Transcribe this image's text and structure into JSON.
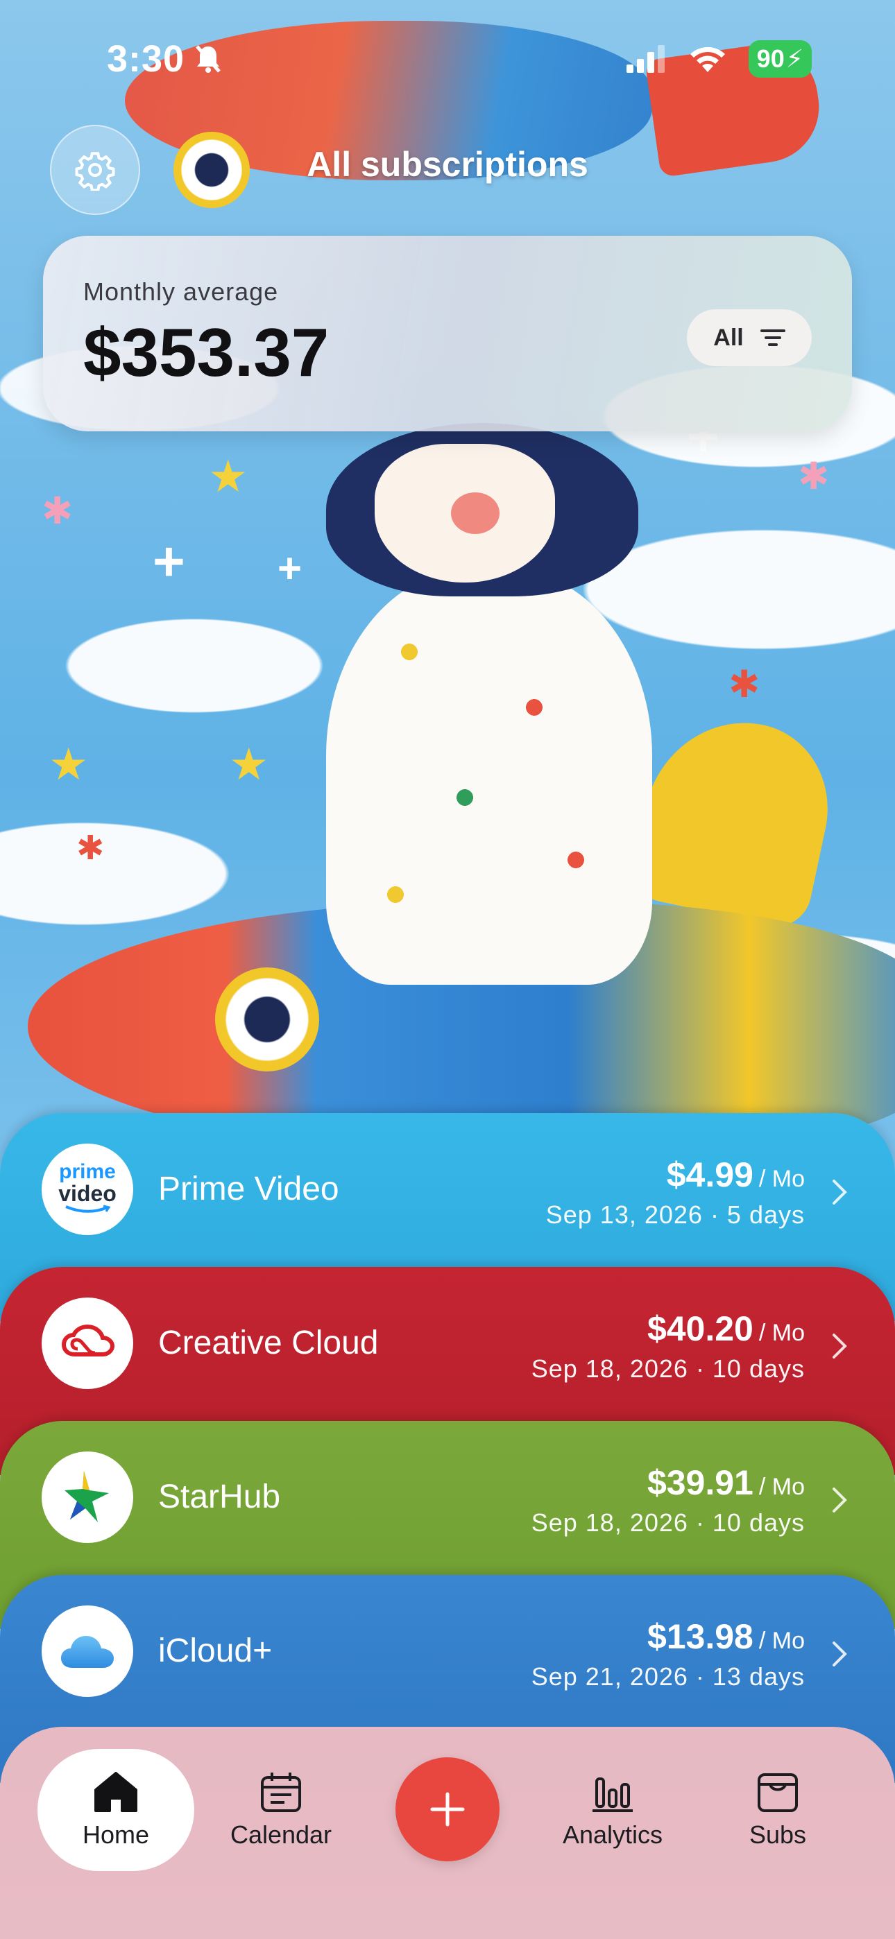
{
  "status_bar": {
    "time": "3:30",
    "battery": "90"
  },
  "header": {
    "title": "All subscriptions"
  },
  "summary": {
    "label": "Monthly average",
    "amount": "$353.37",
    "filter_label": "All"
  },
  "subscriptions": [
    {
      "name": "Prime Video",
      "logo_text_top": "prime",
      "logo_text_bottom": "video",
      "price": "$4.99",
      "period": "/ Mo",
      "date": "Sep 13, 2026 · 5 days",
      "color": "#35b6e6"
    },
    {
      "name": "Creative Cloud",
      "price": "$40.20",
      "period": "/ Mo",
      "date": "Sep 18, 2026 · 10 days",
      "color": "#c22430"
    },
    {
      "name": "StarHub",
      "price": "$39.91",
      "period": "/ Mo",
      "date": "Sep 18, 2026 · 10 days",
      "color": "#7aa83a"
    },
    {
      "name": "iCloud+",
      "price": "$13.98",
      "period": "/ Mo",
      "date": "Sep 21, 2026 · 13 days",
      "color": "#3a86d0"
    }
  ],
  "tabs": {
    "home": "Home",
    "calendar": "Calendar",
    "analytics": "Analytics",
    "subs": "Subs"
  },
  "colors": {
    "accent_red": "#e8473f",
    "tab_bar": "#e6b9c3",
    "battery_green": "#35c759"
  }
}
